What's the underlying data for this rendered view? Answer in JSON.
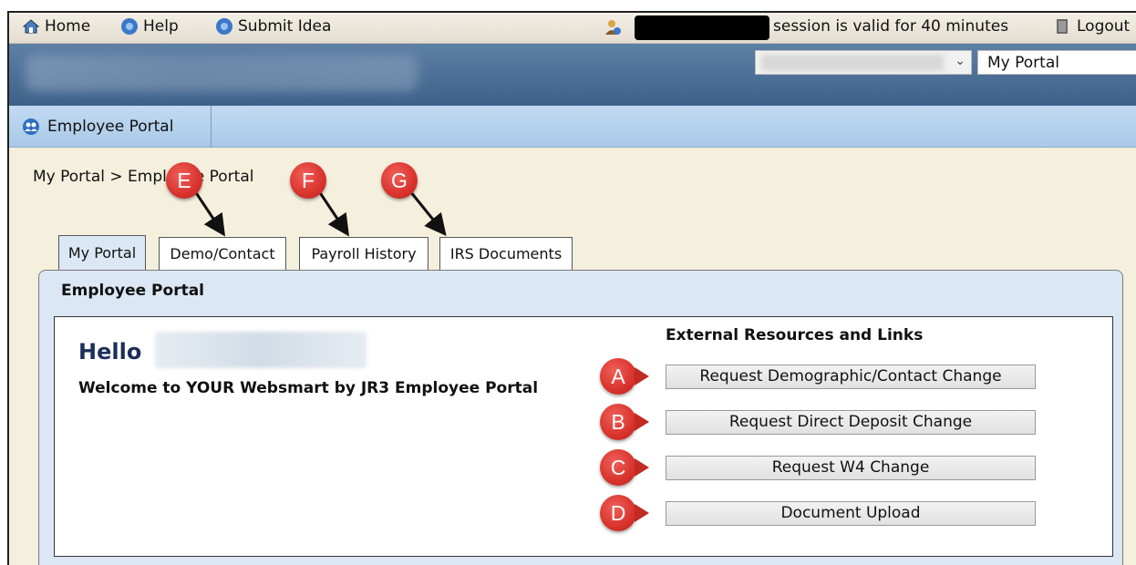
{
  "topbar": {
    "home": "Home",
    "help": "Help",
    "submit_idea": "Submit Idea",
    "session_text": "session is valid for 40 minutes",
    "logout": "Logout"
  },
  "header": {
    "portal_select_value": "My Portal"
  },
  "modulebar": {
    "module_label": "Employee Portal"
  },
  "breadcrumb": "My Portal > Employee Portal",
  "tabs": [
    {
      "label": "My Portal",
      "active": true
    },
    {
      "label": "Demo/Contact",
      "active": false
    },
    {
      "label": "Payroll History",
      "active": false
    },
    {
      "label": "IRS Documents",
      "active": false
    }
  ],
  "panel": {
    "title": "Employee Portal",
    "hello": "Hello",
    "welcome": "Welcome to YOUR Websmart by JR3 Employee Portal",
    "links_title": "External Resources and Links",
    "buttons": [
      "Request Demographic/Contact Change",
      "Request Direct Deposit Change",
      "Request W4 Change",
      "Document Upload"
    ]
  },
  "callouts": {
    "a": "A",
    "b": "B",
    "c": "C",
    "d": "D",
    "e": "E",
    "f": "F",
    "g": "G"
  },
  "colors": {
    "callout_red": "#d8332c",
    "header_blue": "#3d6189",
    "module_bar_blue": "#b5d0ec",
    "panel_blue": "#dbe7f4"
  }
}
